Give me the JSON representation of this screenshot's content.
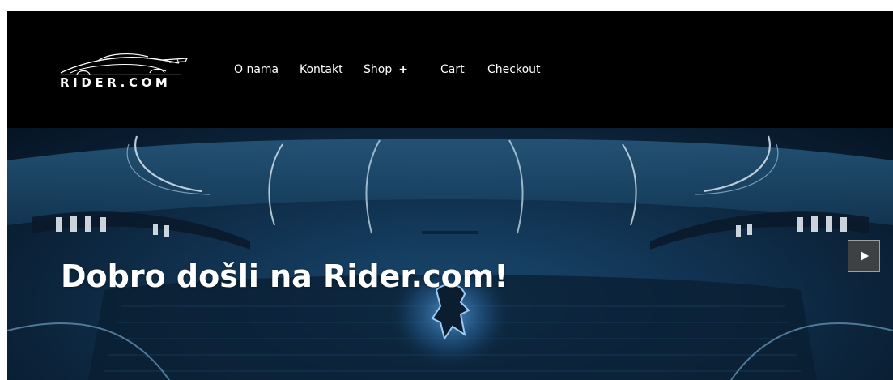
{
  "brand": {
    "name": "RIDER.COM",
    "logo_icon": "sports-car-icon"
  },
  "nav": {
    "items": [
      {
        "label": "O nama"
      },
      {
        "label": "Kontakt"
      },
      {
        "label": "Shop",
        "submenu_indicator": "+"
      },
      {
        "label": "Cart"
      },
      {
        "label": "Checkout"
      }
    ]
  },
  "hero": {
    "title": "Dobro došli na Rider.com!",
    "next_icon": "play-triangle-icon"
  },
  "colors": {
    "header_bg": "#000000",
    "nav_text": "#ffffff",
    "hero_bg": "#123656"
  }
}
